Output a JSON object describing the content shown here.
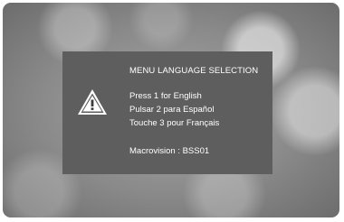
{
  "dialog": {
    "title": "MENU LANGUAGE SELECTION",
    "icon": "warning-icon",
    "options": [
      "Press 1 for English",
      "Pulsar 2 para Español",
      "Touche 3 pour Français"
    ],
    "footer": "Macrovision : BSS01"
  },
  "colors": {
    "dialog_background": "#5e5e5e",
    "text": "#ffffff"
  }
}
